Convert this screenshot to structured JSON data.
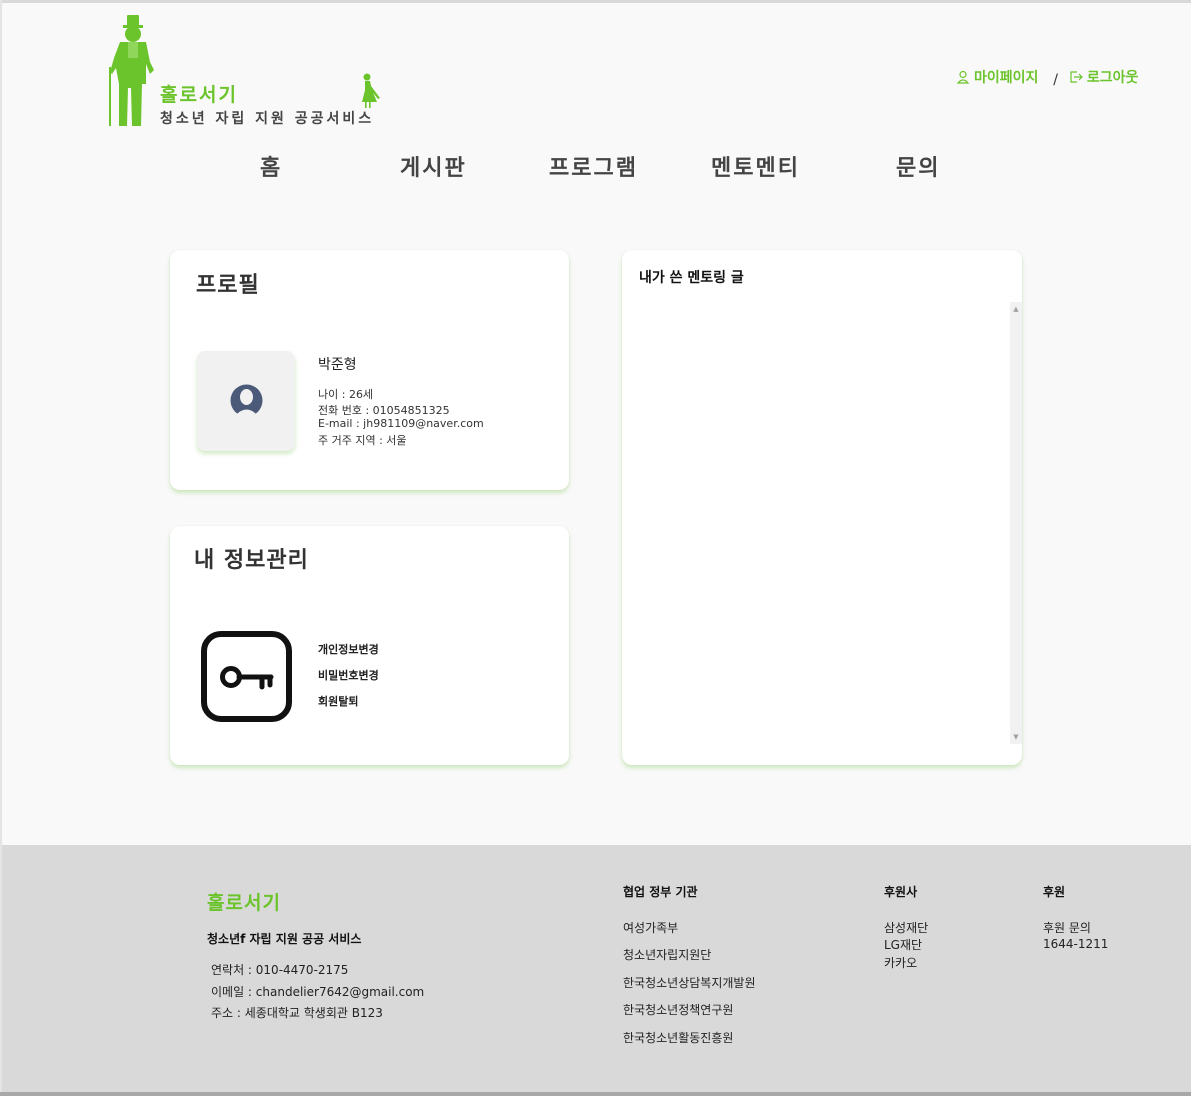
{
  "brand": {
    "name": "홀로서기",
    "subtitle": "청소년 자립 지원 공공서비스"
  },
  "header": {
    "mypage_label": "마이페이지",
    "separator": "/",
    "logout_label": "로그아웃"
  },
  "nav": {
    "items": [
      "홈",
      "게시판",
      "프로그램",
      "멘토멘티",
      "문의"
    ]
  },
  "profile": {
    "title": "프로필",
    "name": "박준형",
    "lines": [
      "나이 : 26세",
      "전화 번호 : 01054851325",
      "E-mail : jh981109@naver.com",
      "주 거주 지역 : 서울"
    ]
  },
  "info": {
    "title": "내 정보관리",
    "links": [
      "개인정보변경",
      "비밀번호변경",
      "회원탈퇴"
    ]
  },
  "mentoring": {
    "title": "내가 쓴 멘토링 글"
  },
  "footer": {
    "brand": "홀로서기",
    "subtitle": "청소년f 자립 지원 공공 서비스",
    "contact": [
      "연락처 : 010-4470-2175",
      "이메일 : chandelier7642@gmail.com",
      "주소 : 세종대학교 학생회관 B123"
    ],
    "agencies": {
      "title": "협업 정부 기관",
      "items": [
        "여성가족부",
        "청소년자립지원단",
        "한국청소년상담복지개발원",
        "한국청소년정책연구원",
        "한국청소년활동진흥원"
      ]
    },
    "sponsors": {
      "title": "후원사",
      "items": [
        "삼성재단",
        "LG재단",
        "카카오"
      ]
    },
    "donation": {
      "title": "후원",
      "items": [
        "후원 문의",
        "1644-1211"
      ]
    }
  },
  "colors": {
    "accent": "#6cc42c",
    "footer_bg": "#d9d9d9",
    "page_bg": "#f9f9f9"
  },
  "icons": {
    "mypage": "user-icon",
    "logout": "logout-icon",
    "avatar": "user-avatar-icon",
    "info": "key-icon"
  }
}
